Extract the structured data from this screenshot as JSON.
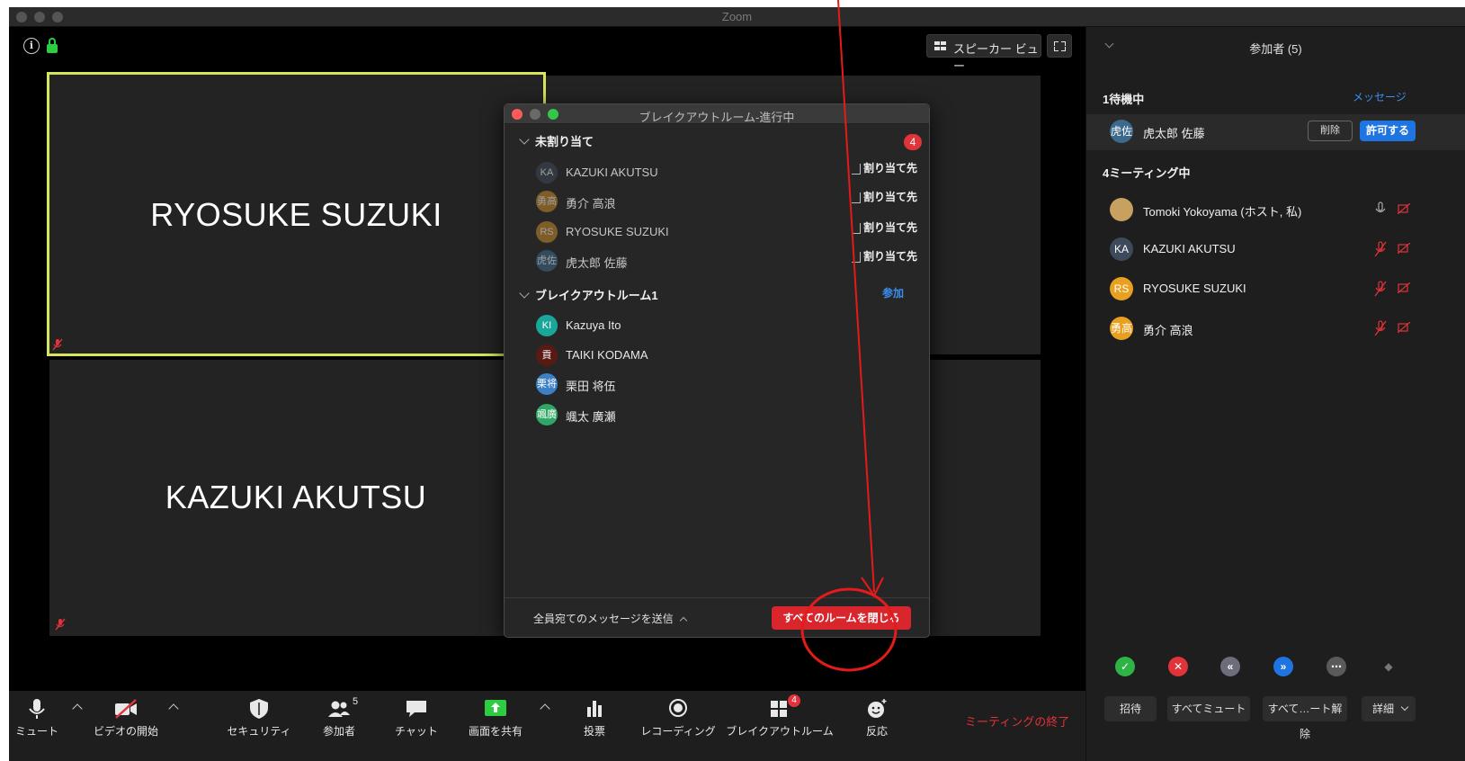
{
  "window": {
    "title": "Zoom"
  },
  "view": {
    "speaker_view": "スピーカー ビュー"
  },
  "tiles": [
    {
      "name": "RYOSUKE SUZUKI"
    },
    {
      "name": "KAZUKI AKUTSU"
    }
  ],
  "breakout": {
    "title": "ブレイクアウトルーム-進行中",
    "unassigned": {
      "label": "未割り当て",
      "count": "4",
      "assign_label": "割り当て先",
      "people": [
        {
          "initials": "KA",
          "name": "KAZUKI AKUTSU",
          "color": "#3c4a5c"
        },
        {
          "initials": "勇高",
          "name": "勇介 高浪",
          "color": "#c98a2c"
        },
        {
          "initials": "RS",
          "name": "RYOSUKE SUZUKI",
          "color": "#c98a2c"
        },
        {
          "initials": "虎佐",
          "name": "虎太郎 佐藤",
          "color": "#3c6a8c"
        }
      ]
    },
    "room1": {
      "label": "ブレイクアウトルーム1",
      "join": "参加",
      "people": [
        {
          "initials": "KI",
          "name": "Kazuya Ito",
          "color": "#1aa79a"
        },
        {
          "initials": "貢",
          "name": "TAIKI KODAMA",
          "color": "#5a1a14"
        },
        {
          "initials": "栗将",
          "name": "栗田 将伍",
          "color": "#3b7fc4"
        },
        {
          "initials": "颯廣",
          "name": "颯太 廣瀬",
          "color": "#2fa866"
        }
      ]
    },
    "send_all": "全員宛てのメッセージを送信",
    "close_all": "すべてのルームを閉じる"
  },
  "toolbar": {
    "mute": "ミュート",
    "video": "ビデオの開始",
    "security": "セキュリティ",
    "participants": "参加者",
    "participants_count": "5",
    "chat": "チャット",
    "share": "画面を共有",
    "poll": "投票",
    "record": "レコーディング",
    "breakout": "ブレイクアウトルーム",
    "breakout_badge": "4",
    "reactions": "反応",
    "end": "ミーティングの終了"
  },
  "panel": {
    "title": "参加者 (5)",
    "waiting_label": "1待機中",
    "message_link": "メッセージ",
    "waiting_person": {
      "initials": "虎佐",
      "name": "虎太郎 佐藤",
      "color": "#3c6a8c"
    },
    "remove": "削除",
    "admit": "許可する",
    "inmeeting_label": "4ミーティング中",
    "people": [
      {
        "initials": "",
        "name": "Tomoki Yokoyama (ホスト, 私)",
        "color": "#c8a060"
      },
      {
        "initials": "KA",
        "name": "KAZUKI AKUTSU",
        "color": "#3c4a5c"
      },
      {
        "initials": "RS",
        "name": "RYOSUKE SUZUKI",
        "color": "#e8a020"
      },
      {
        "initials": "勇高",
        "name": "勇介 高浪",
        "color": "#e8a020"
      }
    ],
    "invite": "招待",
    "mute_all": "すべてミュート",
    "unmute_all": "すべて…ート解除",
    "more": "詳細"
  },
  "colors": {
    "accent": "#1e74e0",
    "danger": "#e0333a",
    "tile_highlight": "#d5e55c"
  }
}
